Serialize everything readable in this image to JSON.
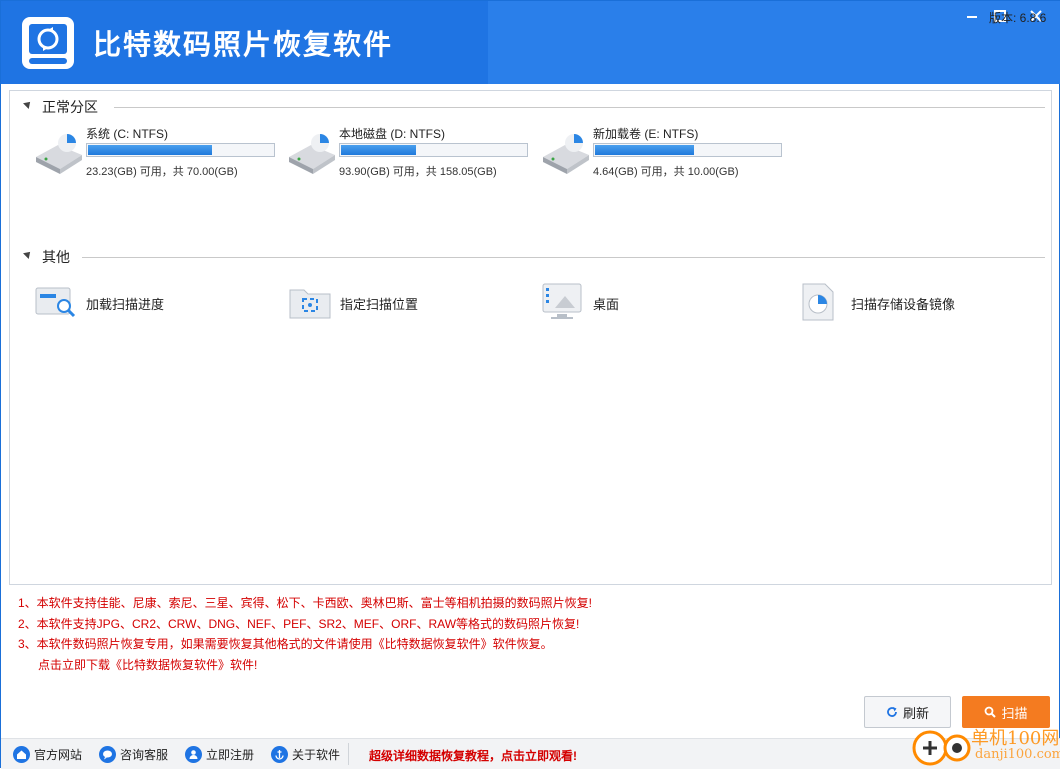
{
  "app": {
    "title": "比特数码照片恢复软件"
  },
  "window_controls": {
    "minimize": "—",
    "maximize": "☐",
    "close": "✕"
  },
  "sections": {
    "normal": {
      "label": "正常分区"
    },
    "other": {
      "label": "其他"
    }
  },
  "drives": [
    {
      "name": "系统 (C: NTFS)",
      "capacity": "23.23(GB) 可用，共 70.00(GB)",
      "used_fraction": 0.668
    },
    {
      "name": "本地磁盘 (D: NTFS)",
      "capacity": "93.90(GB) 可用，共 158.05(GB)",
      "used_fraction": 0.406
    },
    {
      "name": "新加载卷 (E: NTFS)",
      "capacity": "4.64(GB) 可用，共 10.00(GB)",
      "used_fraction": 0.536
    }
  ],
  "others": [
    {
      "label": "加载扫描进度",
      "icon": "load-progress-icon"
    },
    {
      "label": "指定扫描位置",
      "icon": "folder-target-icon"
    },
    {
      "label": "桌面",
      "icon": "desktop-icon"
    },
    {
      "label": "扫描存储设备镜像",
      "icon": "disk-image-icon"
    }
  ],
  "notes": [
    "1、本软件支持佳能、尼康、索尼、三星、宾得、松下、卡西欧、奥林巴斯、富士等相机拍摄的数码照片恢复!",
    "2、本软件支持JPG、CR2、CRW、DNG、NEF、PEF、SR2、MEF、ORF、RAW等格式的数码照片恢复!",
    "3、本软件数码照片恢复专用，如果需要恢复其他格式的文件请使用《比特数据恢复软件》软件恢复。",
    "点击立即下载《比特数据恢复软件》软件!"
  ],
  "buttons": {
    "refresh": "刷新",
    "scan": "扫描"
  },
  "statusbar": {
    "items": [
      "官方网站",
      "咨询客服",
      "立即注册",
      "关于软件"
    ],
    "promo": "超级详细数据恢复教程，点击立即观看!",
    "version": "版本: 6.8.6"
  },
  "watermark": {
    "text": "单机100网",
    "sub": "danji100.com"
  },
  "colors": {
    "brand": "#1f74e3",
    "accent": "#f47b20",
    "note": "#d40000"
  }
}
